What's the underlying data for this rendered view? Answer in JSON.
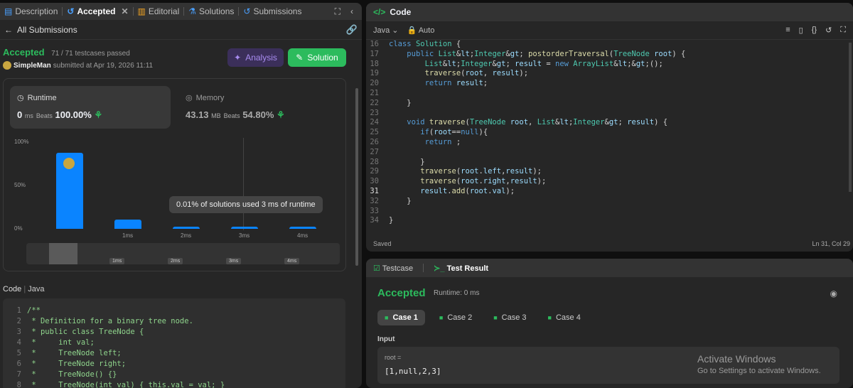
{
  "left_tabs": {
    "description": "Description",
    "accepted": "Accepted",
    "editorial": "Editorial",
    "solutions": "Solutions",
    "submissions": "Submissions"
  },
  "all_submissions": "All Submissions",
  "result": {
    "status": "Accepted",
    "passed": "71 / 71 testcases passed",
    "user": "SimpleMan",
    "submitted": "submitted at Apr 19, 2026 11:11",
    "analysis_label": "Analysis",
    "solution_label": "Solution"
  },
  "runtime": {
    "label": "Runtime",
    "value": "0",
    "unit": "ms",
    "beats_label": "Beats",
    "beats": "100.00%"
  },
  "memory": {
    "label": "Memory",
    "value": "43.13",
    "unit": "MB",
    "beats_label": "Beats",
    "beats": "54.80%"
  },
  "chart_data": {
    "type": "bar",
    "categories": [
      "0ms",
      "1ms",
      "2ms",
      "3ms",
      "4ms"
    ],
    "x_tick_labels": [
      "",
      "1ms",
      "2ms",
      "3ms",
      "4ms"
    ],
    "values": [
      88,
      11,
      2,
      1,
      1
    ],
    "y_tick_labels": [
      "100%",
      "50%",
      "0%"
    ],
    "ylim": [
      0,
      100
    ],
    "tooltip": "0.01% of solutions used 3 ms of runtime",
    "mini_labels": [
      "1ms",
      "2ms",
      "3ms",
      "4ms"
    ]
  },
  "submitted_code": {
    "header": "Code",
    "lang": "Java",
    "lines": [
      {
        "n": "1",
        "t": "/**"
      },
      {
        "n": "2",
        "t": " * Definition for a binary tree node."
      },
      {
        "n": "3",
        "t": " * public class TreeNode {"
      },
      {
        "n": "4",
        "t": " *     int val;"
      },
      {
        "n": "5",
        "t": " *     TreeNode left;"
      },
      {
        "n": "6",
        "t": " *     TreeNode right;"
      },
      {
        "n": "7",
        "t": " *     TreeNode() {}"
      },
      {
        "n": "8",
        "t": " *     TreeNode(int val) { this.val = val; }"
      }
    ]
  },
  "editor": {
    "title": "Code",
    "lang": "Java",
    "mode": "Auto",
    "saved": "Saved",
    "cursor": "Ln 31, Col 29",
    "lines": [
      {
        "n": "16",
        "t": "class Solution {"
      },
      {
        "n": "17",
        "t": "    public List<Integer> postorderTraversal(TreeNode root) {"
      },
      {
        "n": "18",
        "t": "        List<Integer> result = new ArrayList<>();"
      },
      {
        "n": "19",
        "t": "        traverse(root, result);"
      },
      {
        "n": "20",
        "t": "        return result;"
      },
      {
        "n": "21",
        "t": ""
      },
      {
        "n": "22",
        "t": "    }"
      },
      {
        "n": "23",
        "t": ""
      },
      {
        "n": "24",
        "t": "    void traverse(TreeNode root, List<Integer> result) {"
      },
      {
        "n": "25",
        "t": "       if(root==null){"
      },
      {
        "n": "26",
        "t": "        return ;"
      },
      {
        "n": "27",
        "t": ""
      },
      {
        "n": "28",
        "t": "       }"
      },
      {
        "n": "29",
        "t": "       traverse(root.left,result);"
      },
      {
        "n": "30",
        "t": "       traverse(root.right,result);"
      },
      {
        "n": "31",
        "t": "       result.add(root.val);"
      },
      {
        "n": "32",
        "t": "    }"
      },
      {
        "n": "33",
        "t": ""
      },
      {
        "n": "34",
        "t": "}"
      }
    ]
  },
  "test": {
    "tab_testcase": "Testcase",
    "tab_result": "Test Result",
    "status": "Accepted",
    "runtime": "Runtime: 0 ms",
    "cases": [
      "Case 1",
      "Case 2",
      "Case 3",
      "Case 4"
    ],
    "input_label": "Input",
    "var_name": "root =",
    "var_value": "[1,null,2,3]"
  },
  "watermark": {
    "title": "Activate Windows",
    "sub": "Go to Settings to activate Windows."
  },
  "colors": {
    "accent_green": "#2cbb5d",
    "bar_blue": "#0a84ff",
    "analysis_purple": "#a88cf0"
  }
}
